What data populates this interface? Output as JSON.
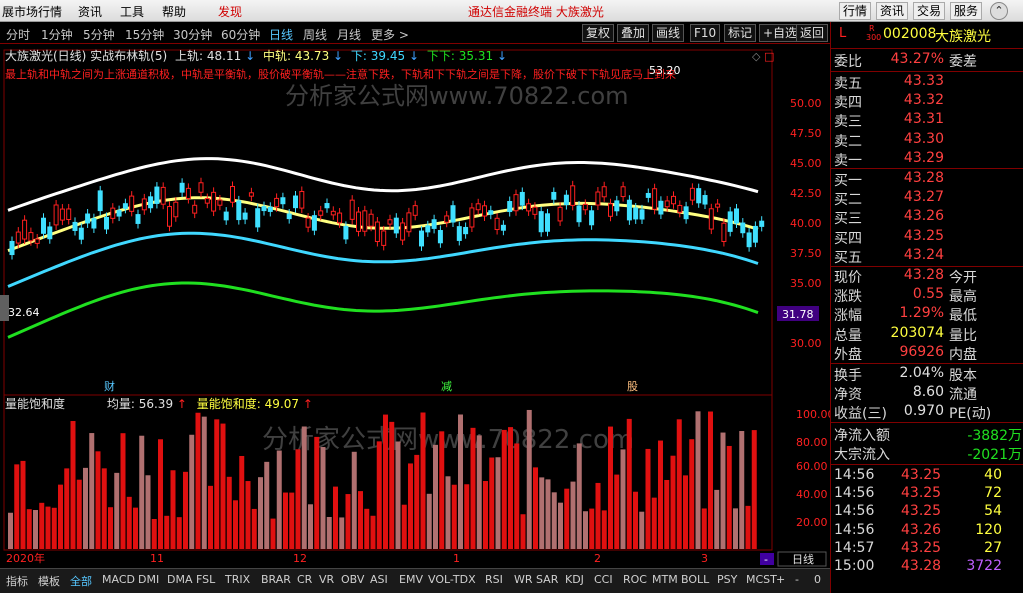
{
  "menubar": {
    "items": [
      "展市场行情",
      "资讯",
      "工具",
      "帮助"
    ],
    "alert": "发现",
    "center_title": "通达信金融终端   大族激光",
    "right_buttons": [
      "行情",
      "资讯",
      "交易",
      "服务"
    ]
  },
  "periods": [
    "分时",
    "1分钟",
    "5分钟",
    "15分钟",
    "30分钟",
    "60分钟",
    "日线",
    "周线",
    "月线",
    "更多 >"
  ],
  "active_period": "日线",
  "tools": [
    "复权",
    "叠加",
    "画线",
    "F10",
    "标记",
    "+自选",
    "返回"
  ],
  "indicator": {
    "title": "大族激光(日线) 实战布林轨(5)",
    "upper_label": "上轨:",
    "upper": "48.11",
    "middle_label": "中轨:",
    "middle": "43.73",
    "lower_label": "下:",
    "lower": "39.45",
    "lower2_label": "下下:",
    "lower2": "35.31",
    "description": "最上轨和中轨之间为上涨通道积极，中轨是平衡轨，股价破平衡轨——注意下跌，下轨和下下轨之间是下降，股价下破下下轨见底马上到来"
  },
  "watermark": "分析家公式网www.70822.com",
  "price_axis": [
    "50.00",
    "47.50",
    "45.00",
    "42.50",
    "40.00",
    "37.50",
    "35.00",
    "32.50",
    "30.00"
  ],
  "high_marker": "53.20",
  "low_marker": "32.64",
  "crosshair_price": "31.78",
  "event_marks": [
    "财",
    "减",
    "股"
  ],
  "volume_indicator": {
    "title": "量能饱和度",
    "avg_label": "均量:",
    "avg": "56.39",
    "sat_label": "量能饱和度:",
    "sat": "49.07"
  },
  "volume_axis": [
    "100.00",
    "80.00",
    "60.00",
    "40.00",
    "20.00"
  ],
  "date_axis": [
    "2020年",
    "11",
    "12",
    "1",
    "2",
    "3"
  ],
  "chart_period_label": "日线",
  "quote": {
    "symbol_l": "L",
    "r_mark": "R",
    "r_code": "300",
    "code": "002008",
    "name": "大族激光",
    "weibi_label": "委比",
    "weibi": "43.27%",
    "weicha_label": "委差",
    "asks": [
      {
        "label": "卖五",
        "price": "43.33"
      },
      {
        "label": "卖四",
        "price": "43.32"
      },
      {
        "label": "卖三",
        "price": "43.31"
      },
      {
        "label": "卖二",
        "price": "43.30"
      },
      {
        "label": "卖一",
        "price": "43.29"
      }
    ],
    "bids": [
      {
        "label": "买一",
        "price": "43.28"
      },
      {
        "label": "买二",
        "price": "43.27"
      },
      {
        "label": "买三",
        "price": "43.26"
      },
      {
        "label": "买四",
        "price": "43.25"
      },
      {
        "label": "买五",
        "price": "43.24"
      }
    ],
    "stats": [
      {
        "label": "现价",
        "value": "43.28",
        "label2": "今开"
      },
      {
        "label": "涨跌",
        "value": "0.55",
        "label2": "最高"
      },
      {
        "label": "涨幅",
        "value": "1.29%",
        "label2": "最低"
      },
      {
        "label": "总量",
        "value": "203074",
        "label2": "量比"
      },
      {
        "label": "外盘",
        "value": "96926",
        "label2": "内盘"
      }
    ],
    "stats2": [
      {
        "label": "换手",
        "value": "2.04%",
        "label2": "股本"
      },
      {
        "label": "净资",
        "value": "8.60",
        "label2": "流通"
      },
      {
        "label": "收益(三)",
        "value": "0.970",
        "label2": "PE(动)"
      }
    ],
    "flows": [
      {
        "label": "净流入额",
        "value": "-3882万"
      },
      {
        "label": "大宗流入",
        "value": "-2021万"
      }
    ],
    "ticks": [
      {
        "time": "14:56",
        "price": "43.25",
        "vol": "40"
      },
      {
        "time": "14:56",
        "price": "43.25",
        "vol": "72"
      },
      {
        "time": "14:56",
        "price": "43.25",
        "vol": "54"
      },
      {
        "time": "14:56",
        "price": "43.26",
        "vol": "120"
      },
      {
        "time": "14:57",
        "price": "43.25",
        "vol": "27"
      },
      {
        "time": "15:00",
        "price": "43.28",
        "vol": "3722"
      }
    ]
  },
  "tabs": [
    "指标",
    "模板",
    "全部",
    "MACD",
    "DMI",
    "DMA",
    "FSL",
    "TRIX",
    "BRAR",
    "CR",
    "VR",
    "OBV",
    "ASI",
    "EMV",
    "VOL-TDX",
    "RSI",
    "WR",
    "SAR",
    "KDJ",
    "CCI",
    "ROC",
    "MTM",
    "BOLL",
    "PSY",
    "MCST"
  ],
  "active_tab": "全部",
  "colors": {
    "upper_band": "#ffffff",
    "middle_band": "#ffff80",
    "lower_band": "#40d8ff",
    "lower2_band": "#20e020",
    "rise": "#ff2020",
    "fall": "#40e0ff"
  }
}
